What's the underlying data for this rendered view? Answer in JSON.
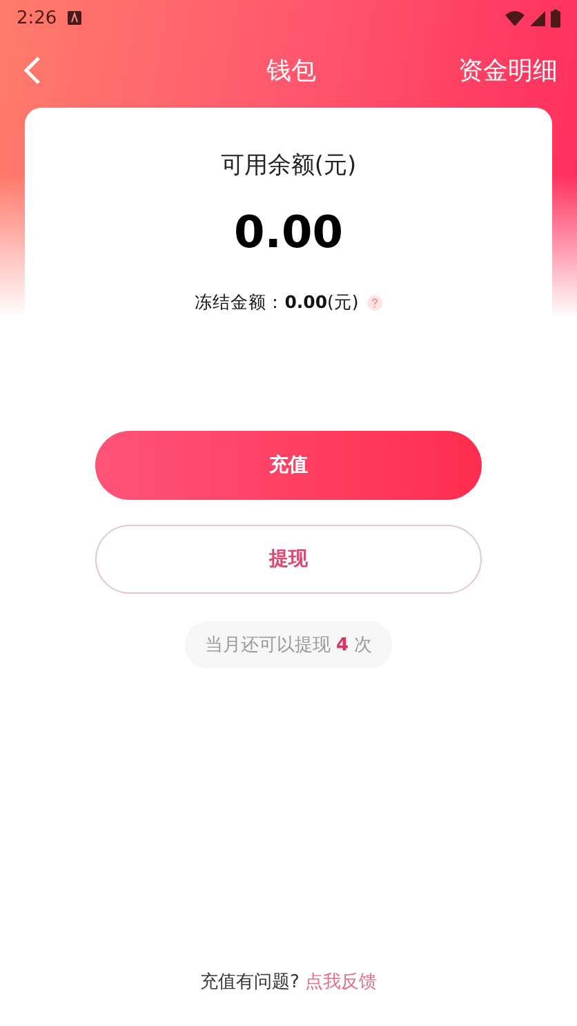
{
  "status_bar": {
    "time": "2:26"
  },
  "nav": {
    "title": "钱包",
    "action": "资金明细"
  },
  "balance": {
    "label": "可用余额(元)",
    "amount": "0.00",
    "frozen_label": "冻结金额：",
    "frozen_amount": "0.00",
    "frozen_unit": "(元)"
  },
  "buttons": [
    {
      "label": "充值",
      "kind": "primary"
    },
    {
      "label": "提现",
      "kind": "outline"
    }
  ],
  "tip": "当月还可以提现 **4** 次",
  "footer": {
    "question": "充值有问题?",
    "link": "点我反馈"
  }
}
